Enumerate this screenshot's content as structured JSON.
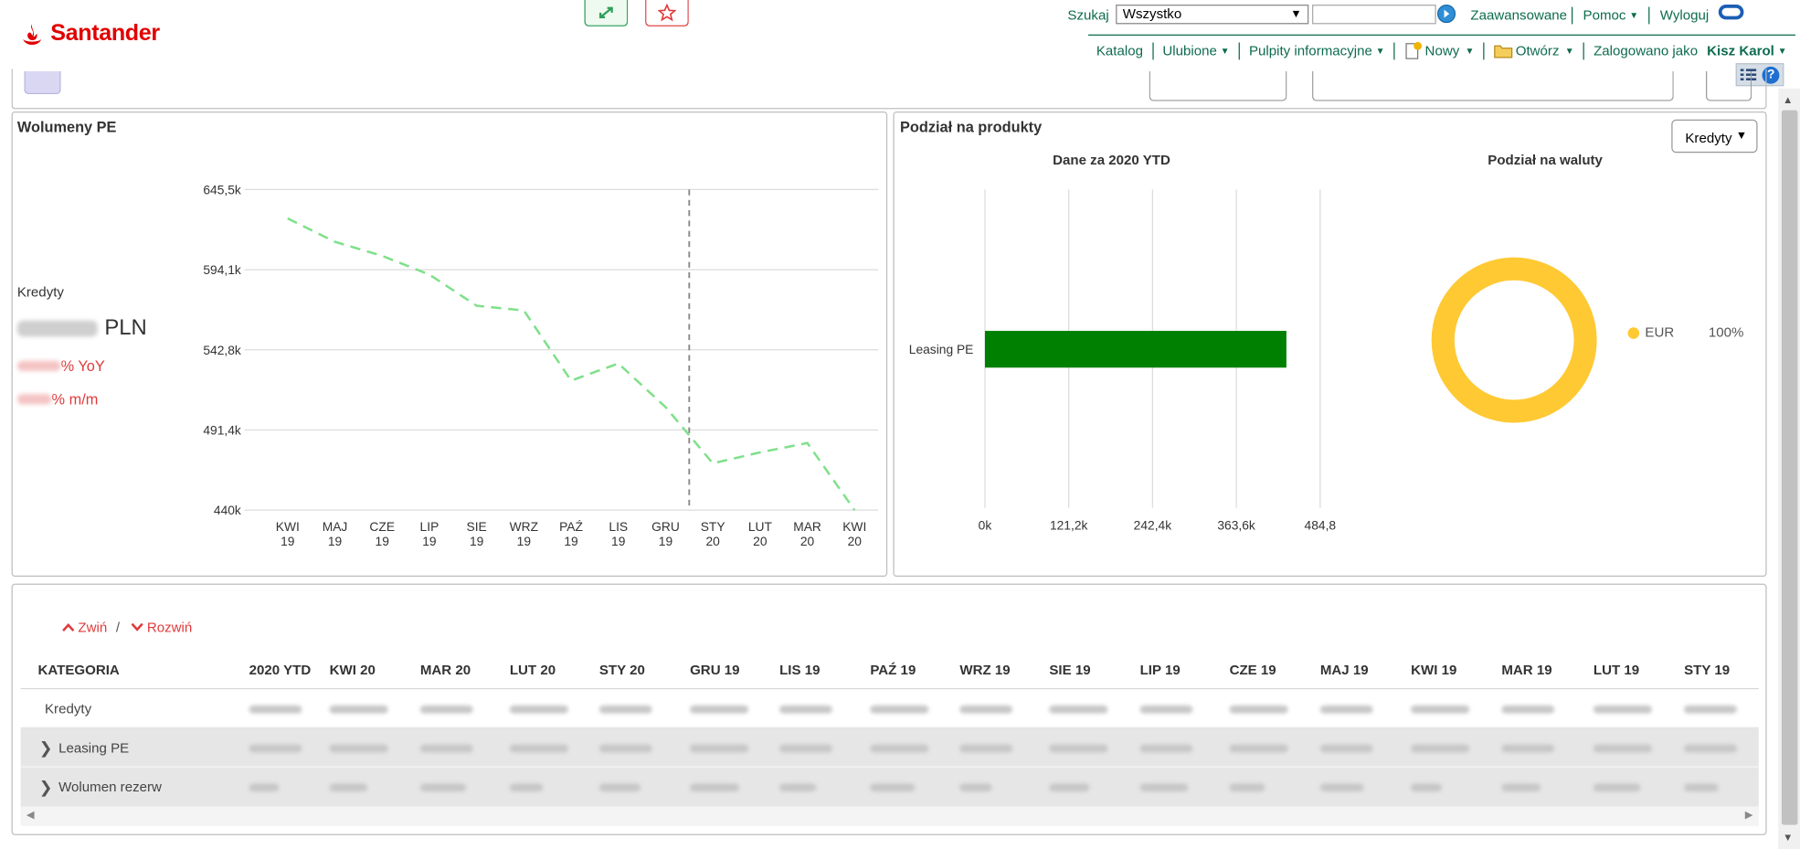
{
  "brand": {
    "name": "Santander",
    "color": "#e00000",
    "accent": "#0d6b4e"
  },
  "header": {
    "expand_icon": "expand-arrows-icon",
    "favorite_icon": "star-icon",
    "search_label": "Szukaj",
    "search_scope": "Wszystko",
    "search_value": "",
    "links": {
      "advanced": "Zaawansowane",
      "help": "Pomoc",
      "logout": "Wyloguj"
    },
    "nav": {
      "catalog": "Katalog",
      "favorites": "Ulubione",
      "dashboards": "Pulpity informacyjne",
      "new": "Nowy",
      "open": "Otwórz",
      "logged_as": "Zalogowano jako",
      "user": "Kisz Karol"
    }
  },
  "volume_panel": {
    "title": "Wolumeny PE",
    "kpi_label": "Kredyty",
    "kpi_unit": "PLN",
    "kpi_yoy_suffix": "% YoY",
    "kpi_mm_suffix": "% m/m"
  },
  "product_panel": {
    "title": "Podział na produkty",
    "dropdown": "Kredyty",
    "bar_title": "Dane za 2020 YTD",
    "donut_title": "Podział na waluty"
  },
  "chart_data": [
    {
      "type": "line",
      "title": "Wolumeny PE",
      "categories": [
        "KWI 19",
        "MAJ 19",
        "CZE 19",
        "LIP 19",
        "SIE 19",
        "WRZ 19",
        "PAŹ 19",
        "LIS 19",
        "GRU 19",
        "STY 20",
        "LUT 20",
        "MAR 20",
        "KWI 20"
      ],
      "series": [
        {
          "values": [
            627,
            612,
            603,
            591,
            571,
            568,
            523,
            534,
            506,
            470,
            477,
            483,
            440
          ],
          "color": "#7fe08a"
        }
      ],
      "y_ticks": [
        "645,5k",
        "594,1k",
        "542,8k",
        "491,4k",
        "440k"
      ],
      "ylim": [
        440,
        645.5
      ],
      "divider_after": "GRU 19",
      "grid": true
    },
    {
      "type": "bar",
      "orientation": "horizontal",
      "title": "Dane za 2020 YTD",
      "categories": [
        "Leasing PE"
      ],
      "values": [
        436
      ],
      "x_ticks": [
        "0k",
        "121,2k",
        "242,4k",
        "363,6k",
        "484,8"
      ],
      "xlim": [
        0,
        484.8
      ],
      "color": "#008000"
    },
    {
      "type": "pie",
      "title": "Podział na waluty",
      "labels": [
        "EUR"
      ],
      "values": [
        100
      ],
      "value_labels": [
        "100%"
      ],
      "color": "#ffc933"
    }
  ],
  "table": {
    "collapse": "Zwiń",
    "separator": "/",
    "expand": "Rozwiń",
    "columns": [
      "KATEGORIA",
      "2020 YTD",
      "KWI 20",
      "MAR 20",
      "LUT 20",
      "STY 20",
      "GRU 19",
      "LIS 19",
      "PAŹ 19",
      "WRZ 19",
      "SIE 19",
      "LIP 19",
      "CZE 19",
      "MAJ 19",
      "KWI 19",
      "MAR 19",
      "LUT 19",
      "STY 19"
    ],
    "rows": [
      {
        "label": "Kredyty"
      },
      {
        "label": "Leasing PE"
      },
      {
        "label": "Wolumen rezerw"
      }
    ]
  }
}
